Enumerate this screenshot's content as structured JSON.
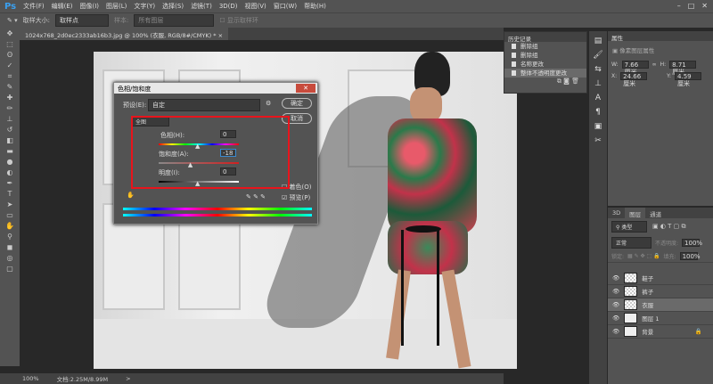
{
  "app": {
    "logo": "Ps",
    "menu": [
      "文件(F)",
      "编辑(E)",
      "图像(I)",
      "图层(L)",
      "文字(Y)",
      "选择(S)",
      "滤镜(T)",
      "3D(D)",
      "视图(V)",
      "窗口(W)",
      "帮助(H)"
    ],
    "window_controls": [
      "–",
      "□",
      "✕"
    ]
  },
  "options": {
    "sample_size_label": "取样大小:",
    "sample_size_value": "取样点",
    "sample_label": "样本:",
    "sample_value": "所有图层",
    "show_ring": "显示取样环"
  },
  "document": {
    "tab": "1024x768_2d0ec2333ab16b3.jpg @ 100% (衣服, RGB/8#/CMYK) *",
    "tab_close": "×"
  },
  "status": {
    "zoom": "100%",
    "doc": "文档:2.25M/8.99M",
    "arrow": ">"
  },
  "dialog": {
    "title": "色相/饱和度",
    "close": "✕",
    "preset_label": "预设(E):",
    "preset_value": "自定",
    "ok": "确定",
    "cancel": "取消",
    "channel": "全图",
    "hue_label": "色相(H):",
    "hue_value": "0",
    "sat_label": "饱和度(A):",
    "sat_value": "-18",
    "light_label": "明度(I):",
    "light_value": "0",
    "colorize": "着色(O)",
    "preview": "预览(P)",
    "hue": 0,
    "saturation": -18,
    "lightness": 0,
    "highlight_color": "#e8141c"
  },
  "history": {
    "title": "历史记录",
    "items": [
      "删除组",
      "删除组",
      "名称更改",
      "整体不透明度更改"
    ]
  },
  "properties": {
    "title": "属性",
    "subtitle": "像素图层属性",
    "w_label": "W:",
    "w": "7.66 厘米",
    "h_label": "H:",
    "h": "8.71 厘米",
    "x_label": "X:",
    "x": "24.66 厘米",
    "y_label": "Y:",
    "y": "4.59 厘米"
  },
  "layers": {
    "tabs": [
      "3D",
      "图层",
      "通道"
    ],
    "filter": "类型",
    "blend": "正常",
    "opacity_label": "不透明度:",
    "opacity": "100%",
    "lock_label": "锁定:",
    "fill_label": "填充:",
    "fill": "100%",
    "items": [
      "鞋子",
      "裤子",
      "衣服",
      "图层 1",
      "背景"
    ],
    "active": "衣服"
  }
}
